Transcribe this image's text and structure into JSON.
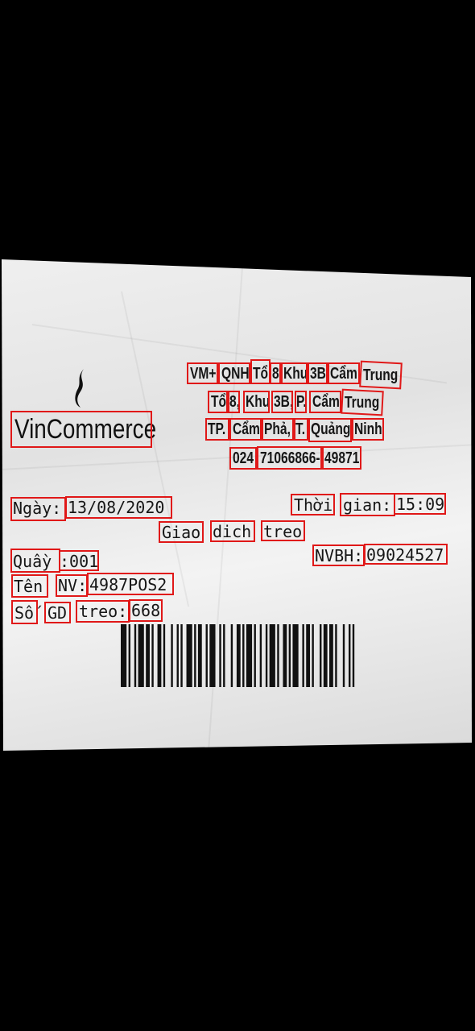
{
  "logo": {
    "text": "VinCommerce",
    "icon": "vinmart-flame-icon"
  },
  "store_header": {
    "line1": [
      "VM+",
      "QNH",
      "Tổ",
      "8",
      "Khu",
      "3B",
      "Cẩm",
      "Trung"
    ],
    "line2": [
      "Tổ",
      "8,",
      "Khu",
      "3B,",
      "P.",
      "Cẩm",
      "Trung"
    ],
    "line3": [
      "TP.",
      "Cẩm",
      "Phả,",
      "T.",
      "Quảng",
      "Ninh"
    ],
    "line4": [
      "024",
      "71066866-",
      "49871"
    ]
  },
  "info": {
    "date_label": "Ngày:",
    "date_value": "13/08/2020",
    "time_label_1": "Thời",
    "time_label_2": "gian:",
    "time_value": "15:09",
    "title": [
      "Giao",
      "dich",
      "treo"
    ],
    "counter_label": "Quầy",
    "counter_value": ":001",
    "nvbh_label": "NVBH:",
    "nvbh_value": "09024527",
    "name_label_1": "Tên",
    "name_label_2": "NV:",
    "name_value": "4987POS2",
    "suspend_label_1": "Số",
    "suspend_label_2": "GD",
    "suspend_label_3": "treo:",
    "suspend_value": "668"
  },
  "colors": {
    "annotation_box": "#e01818",
    "background": "#000000",
    "paper": "#e8e8e8"
  }
}
